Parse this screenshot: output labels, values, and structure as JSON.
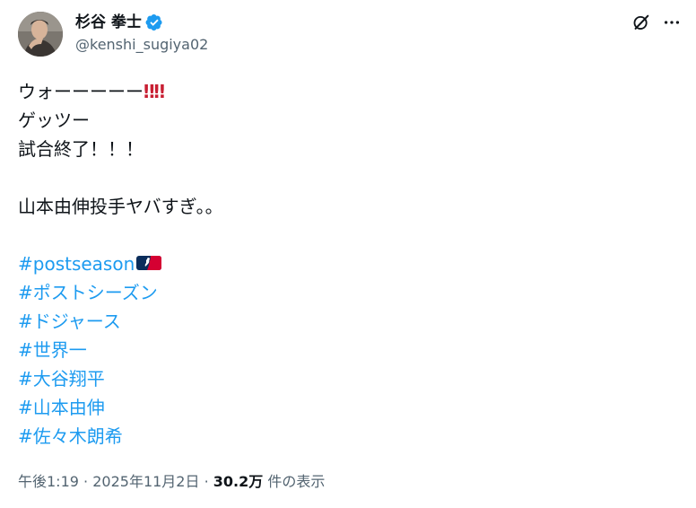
{
  "author": {
    "display_name": "杉谷 拳士",
    "handle": "@kenshi_sugiya02",
    "verified": true
  },
  "icons": {
    "verified": "verified-badge-icon",
    "grok": "grok-icon",
    "more": "more-options-icon",
    "emoji": "mlb-logo-emoji"
  },
  "colors": {
    "link": "#1d9bf0",
    "verified": "#1d9bf0",
    "text": "#0f1419",
    "secondary": "#536471",
    "exclamation": "#c81e32"
  },
  "tweet": {
    "line1": "ウォーーーーー",
    "line1_emoji": "‼‼",
    "line2": "ゲッツー",
    "line3": "試合終了！！！",
    "line4": "山本由伸投手ヤバすぎ。。",
    "hashtags": [
      "#postseason",
      "#ポストシーズン",
      "#ドジャース",
      "#世界一",
      "#大谷翔平",
      "#山本由伸",
      "#佐々木朗希"
    ]
  },
  "meta": {
    "time": "午後1:19",
    "separator": "·",
    "date": "2025年11月2日",
    "views": "30.2万",
    "views_label": "件の表示"
  }
}
